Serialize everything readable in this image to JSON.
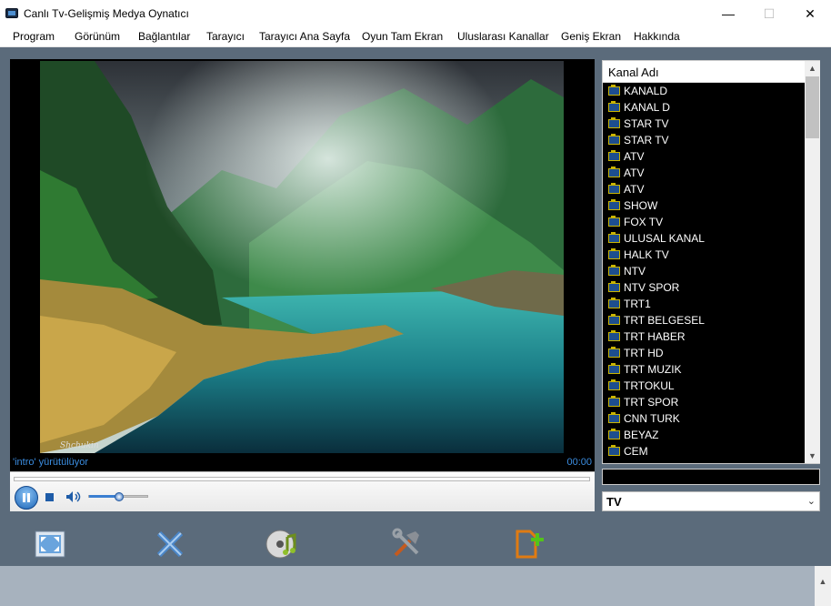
{
  "window": {
    "title": "Canlı Tv-Gelişmiş Medya Oynatıcı",
    "controls": {
      "minimize": "—",
      "maximize": "☐",
      "close": "✕"
    }
  },
  "menu": [
    "Program",
    "Görünüm",
    "Bağlantılar",
    "Tarayıcı",
    "Tarayıcı Ana Sayfa",
    "Oyun Tam Ekran",
    "Uluslarası Kanallar",
    "Geniş Ekran",
    "Hakkında"
  ],
  "player": {
    "status": "'intro' yürütülüyor",
    "time": "00:00",
    "video_watermark": "Shchukin",
    "volume_level": 0.5,
    "icons": {
      "play_pause": "pause-icon",
      "stop": "stop-icon",
      "volume": "speaker-icon"
    }
  },
  "channels": {
    "header": "Kanal Adı",
    "items": [
      "KANALD",
      "KANAL D",
      "STAR TV",
      "STAR TV",
      "ATV",
      "ATV",
      "ATV",
      "SHOW",
      "FOX TV",
      "ULUSAL KANAL",
      "HALK TV",
      "NTV",
      "NTV SPOR",
      "TRT1",
      "TRT BELGESEL",
      "TRT HABER",
      "TRT HD",
      "TRT MUZIK",
      "TRTOKUL",
      "TRT SPOR",
      "CNN TURK",
      "BEYAZ",
      "CEM"
    ]
  },
  "search": {
    "value": ""
  },
  "category": {
    "selected": "TV"
  },
  "toolbar": [
    {
      "name": "fullscreen-button",
      "icon": "fullscreen-icon"
    },
    {
      "name": "tools-cross-button",
      "icon": "cross-arrows-icon"
    },
    {
      "name": "music-button",
      "icon": "music-disc-icon"
    },
    {
      "name": "settings-button",
      "icon": "tools-icon"
    },
    {
      "name": "add-channel-button",
      "icon": "add-file-icon"
    }
  ],
  "colors": {
    "accent": "#3b8de0",
    "background": "#5b6b7b",
    "list_bg": "#000000"
  }
}
